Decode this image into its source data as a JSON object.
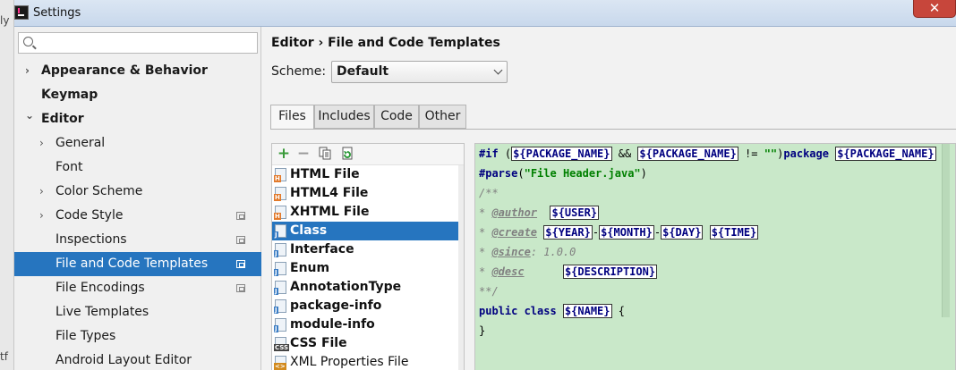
{
  "window": {
    "title": "Settings"
  },
  "ide": {
    "fragments": [
      "ly",
      "tf"
    ]
  },
  "search": {
    "placeholder": ""
  },
  "tree": [
    {
      "label": "Appearance & Behavior",
      "bold": true,
      "arrow": "›",
      "indent": 1,
      "scope": false
    },
    {
      "label": "Keymap",
      "bold": true,
      "arrow": "",
      "indent": 1,
      "scope": false
    },
    {
      "label": "Editor",
      "bold": true,
      "arrow": "⌄",
      "indent": 1,
      "scope": false
    },
    {
      "label": "General",
      "bold": false,
      "arrow": "›",
      "indent": 2,
      "scope": false
    },
    {
      "label": "Font",
      "bold": false,
      "arrow": "",
      "indent": 2,
      "scope": false
    },
    {
      "label": "Color Scheme",
      "bold": false,
      "arrow": "›",
      "indent": 2,
      "scope": false
    },
    {
      "label": "Code Style",
      "bold": false,
      "arrow": "›",
      "indent": 2,
      "scope": true
    },
    {
      "label": "Inspections",
      "bold": false,
      "arrow": "",
      "indent": 2,
      "scope": true
    },
    {
      "label": "File and Code Templates",
      "bold": false,
      "arrow": "",
      "indent": 2,
      "scope": true,
      "selected": true
    },
    {
      "label": "File Encodings",
      "bold": false,
      "arrow": "",
      "indent": 2,
      "scope": true
    },
    {
      "label": "Live Templates",
      "bold": false,
      "arrow": "",
      "indent": 2,
      "scope": false
    },
    {
      "label": "File Types",
      "bold": false,
      "arrow": "",
      "indent": 2,
      "scope": false
    },
    {
      "label": "Android Layout Editor",
      "bold": false,
      "arrow": "",
      "indent": 2,
      "scope": false
    }
  ],
  "breadcrumb": "Editor › File and Code Templates",
  "scheme": {
    "label": "Scheme:",
    "value": "Default"
  },
  "tabs": [
    "Files",
    "Includes",
    "Code",
    "Other"
  ],
  "active_tab": "Files",
  "toolbar": {
    "add": "+",
    "remove": "−",
    "copy": "copy-icon",
    "reset": "reset-icon"
  },
  "files": [
    {
      "label": "HTML File",
      "badge": "H",
      "badge_color": "#e27a2b",
      "bold": true
    },
    {
      "label": "HTML4 File",
      "badge": "H",
      "badge_color": "#e27a2b",
      "bold": true
    },
    {
      "label": "XHTML File",
      "badge": "H",
      "badge_color": "#e27a2b",
      "bold": true
    },
    {
      "label": "Class",
      "badge": "J",
      "badge_color": "#3b7dc4",
      "bold": true,
      "selected": true
    },
    {
      "label": "Interface",
      "badge": "J",
      "badge_color": "#3b7dc4",
      "bold": true
    },
    {
      "label": "Enum",
      "badge": "J",
      "badge_color": "#3b7dc4",
      "bold": true
    },
    {
      "label": "AnnotationType",
      "badge": "J",
      "badge_color": "#3b7dc4",
      "bold": true
    },
    {
      "label": "package-info",
      "badge": "J",
      "badge_color": "#3b7dc4",
      "bold": true
    },
    {
      "label": "module-info",
      "badge": "J",
      "badge_color": "#3b7dc4",
      "bold": true
    },
    {
      "label": "CSS File",
      "badge": "CSS",
      "badge_color": "#444444",
      "bold": true
    },
    {
      "label": "XML Properties File",
      "badge": "<>",
      "badge_color": "#d28a1e",
      "bold": false
    }
  ],
  "code": [
    [
      [
        "kw",
        "#if"
      ],
      [
        "t",
        " ("
      ],
      [
        "var",
        "${PACKAGE_NAME}"
      ],
      [
        "t",
        " && "
      ],
      [
        "var",
        "${PACKAGE_NAME}"
      ],
      [
        "t",
        " != "
      ],
      [
        "str",
        "\"\""
      ],
      [
        "t",
        ")"
      ],
      [
        "kw",
        "package"
      ],
      [
        "t",
        " "
      ],
      [
        "var",
        "${PACKAGE_NAME}"
      ]
    ],
    [
      [
        "kw",
        "#parse"
      ],
      [
        "t",
        "("
      ],
      [
        "str",
        "\"File Header.java\""
      ],
      [
        "t",
        ")"
      ]
    ],
    [
      [
        "cm",
        "/**"
      ]
    ],
    [
      [
        "cm",
        "* "
      ],
      [
        "tag",
        "@author"
      ],
      [
        "t",
        "  "
      ],
      [
        "var",
        "${USER}"
      ]
    ],
    [
      [
        "cm",
        "* "
      ],
      [
        "tag",
        "@create"
      ],
      [
        "t",
        " "
      ],
      [
        "var",
        "${YEAR}"
      ],
      [
        "t",
        "-"
      ],
      [
        "var",
        "${MONTH}"
      ],
      [
        "t",
        "-"
      ],
      [
        "var",
        "${DAY}"
      ],
      [
        "t",
        " "
      ],
      [
        "var",
        "${TIME}"
      ]
    ],
    [
      [
        "cm",
        "* "
      ],
      [
        "tag",
        "@since"
      ],
      [
        "cm",
        ": 1.0.0"
      ]
    ],
    [
      [
        "cm",
        "* "
      ],
      [
        "tag",
        "@desc"
      ],
      [
        "t",
        "      "
      ],
      [
        "var",
        "${DESCRIPTION}"
      ]
    ],
    [
      [
        "cm",
        "**/"
      ]
    ],
    [
      [
        "kw",
        "public class "
      ],
      [
        "var",
        "${NAME}"
      ],
      [
        "t",
        " {"
      ]
    ],
    [
      [
        "t",
        "}"
      ]
    ]
  ]
}
